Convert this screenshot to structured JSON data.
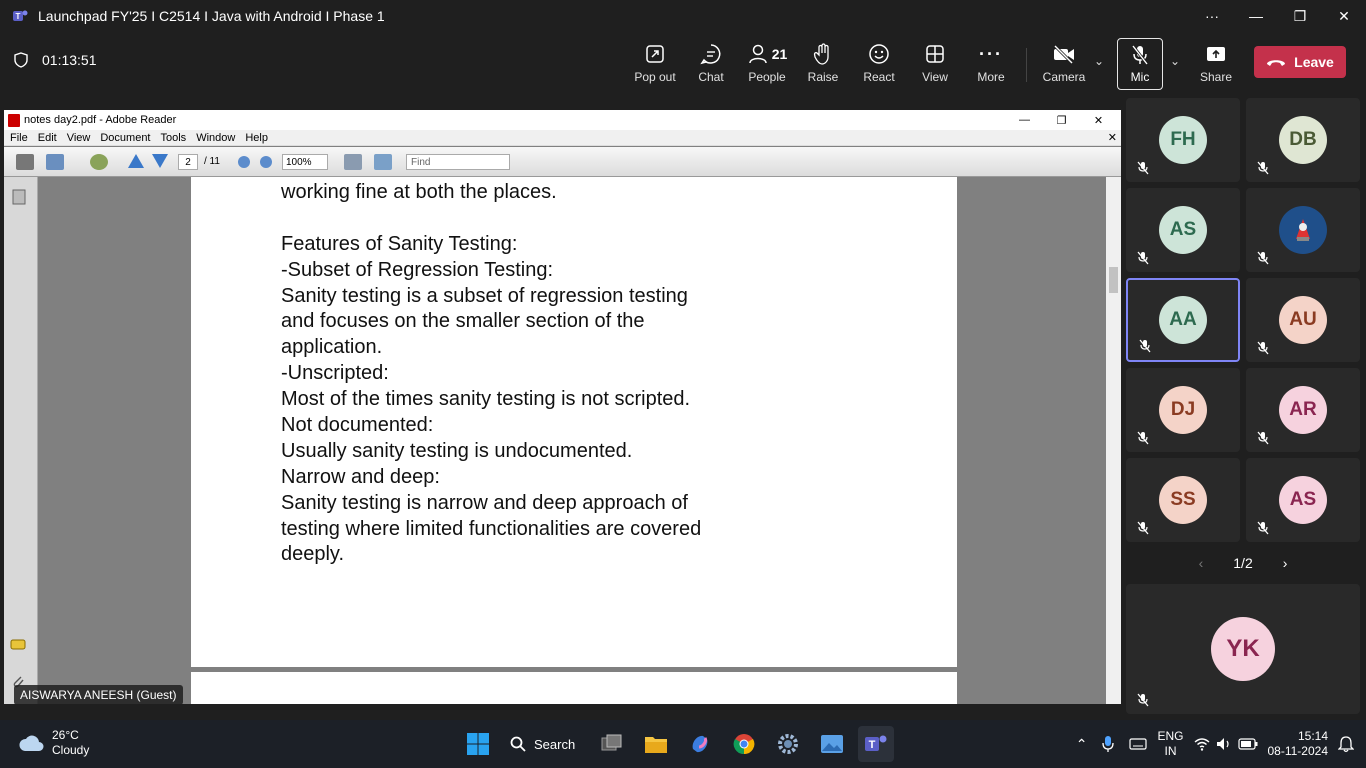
{
  "window": {
    "title": "Launchpad FY'25 I C2514 I Java with Android I Phase 1"
  },
  "meeting": {
    "timer": "01:13:51",
    "toolbar": [
      {
        "id": "popout",
        "label": "Pop out",
        "icon": "popout-icon"
      },
      {
        "id": "chat",
        "label": "Chat",
        "icon": "chat-icon"
      },
      {
        "id": "people",
        "label": "People",
        "icon": "people-icon",
        "count": "21"
      },
      {
        "id": "raise",
        "label": "Raise",
        "icon": "hand-icon"
      },
      {
        "id": "react",
        "label": "React",
        "icon": "smiley-icon"
      },
      {
        "id": "view",
        "label": "View",
        "icon": "grid-icon"
      },
      {
        "id": "more",
        "label": "More",
        "icon": "more-icon"
      },
      {
        "id": "camera",
        "label": "Camera",
        "icon": "camera-off-icon"
      }
    ],
    "mic_label": "Mic",
    "share_label": "Share",
    "leave_label": "Leave",
    "leave_color": "#c4314b"
  },
  "reader": {
    "title": "notes day2.pdf - Adobe Reader",
    "menu": [
      "File",
      "Edit",
      "View",
      "Document",
      "Tools",
      "Window",
      "Help"
    ],
    "page_current": "2",
    "page_total": "/ 11",
    "zoom": "100%",
    "find_placeholder": "Find",
    "lines": [
      "working fine at both the places.",
      "",
      "Features of Sanity Testing:",
      "-Subset of Regression Testing:",
      "Sanity testing is a subset of regression testing",
      "and focuses on the smaller section of the",
      "application.",
      "-Unscripted:",
      "Most of the times sanity testing is not scripted.",
      "Not documented:",
      "Usually sanity testing is undocumented.",
      "Narrow and deep:",
      "Sanity testing is narrow and deep approach of",
      "testing where limited functionalities are covered",
      "deeply."
    ]
  },
  "presenter_name": "AISWARYA ANEESH (Guest)",
  "participants": [
    {
      "initials": "FH",
      "bg": "#cde4d8",
      "fg": "#2d6a4f"
    },
    {
      "initials": "DB",
      "bg": "#dfe6d3",
      "fg": "#4a5a35"
    },
    {
      "initials": "AS",
      "bg": "#cde4d8",
      "fg": "#2d6a4f"
    },
    {
      "initials": "",
      "bg": "#1f4f8a",
      "fg": "#ffffff",
      "image": true
    },
    {
      "initials": "AA",
      "bg": "#cde4d8",
      "fg": "#2d6a4f",
      "active": true
    },
    {
      "initials": "AU",
      "bg": "#f4d3c8",
      "fg": "#8a3b22"
    },
    {
      "initials": "DJ",
      "bg": "#f4d3c8",
      "fg": "#8a3b22"
    },
    {
      "initials": "AR",
      "bg": "#f6d2de",
      "fg": "#8a2550"
    },
    {
      "initials": "SS",
      "bg": "#f4d3c8",
      "fg": "#8a3b22"
    },
    {
      "initials": "AS",
      "bg": "#f6d2de",
      "fg": "#8a2550"
    }
  ],
  "pager": "1/2",
  "big_participant": {
    "initials": "YK",
    "bg": "#f6d2de",
    "fg": "#8a2550"
  },
  "taskbar": {
    "temp": "26°C",
    "weather": "Cloudy",
    "search_label": "Search",
    "lang1": "ENG",
    "lang2": "IN",
    "time": "15:14",
    "date": "08-11-2024"
  }
}
